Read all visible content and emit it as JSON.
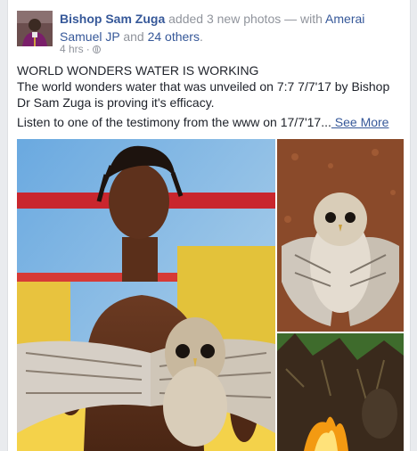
{
  "post": {
    "author": "Bishop Sam Zuga",
    "action": " added 3 new photos — with ",
    "tagged": "Amerai Samuel JP",
    "and": " and ",
    "others": "24 others",
    "period": ".",
    "time": "4 hrs",
    "separator": " · ",
    "line1": "WORLD WONDERS WATER IS WORKING",
    "line2": "The world wonders water that was unveiled on 7:7 7/7'17 by Bishop Dr Sam Zuga is proving it's efficacy.",
    "line3": "Listen to one of the testimony from the www on 17/7'17...",
    "see_more": " See More"
  },
  "icons": {
    "privacy": "globe-icon"
  }
}
